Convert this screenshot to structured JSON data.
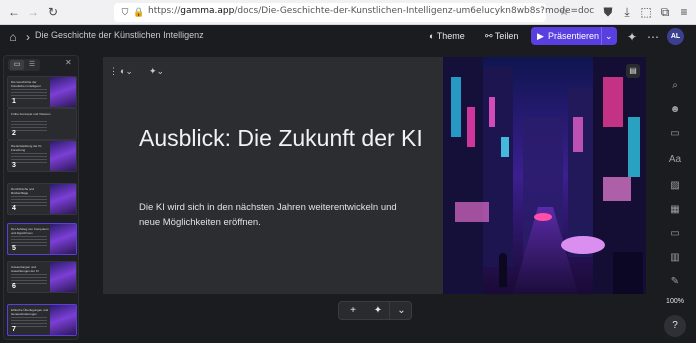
{
  "browser": {
    "url": "https://gamma.app/docs/Die-Geschichte-der-Kunstlichen-Intelligenz-um6elucykn8wb8s?mode=doc",
    "url_prefix": "https://",
    "url_host": "gamma.app",
    "url_path": "/docs/Die-Geschichte-der-Kunstlichen-Intelligenz-um6elucykn8wb8s?mode=doc"
  },
  "header": {
    "doc_title": "Die Geschichte der Künstlichen Intelligenz",
    "theme_label": "Theme",
    "share_label": "Teilen",
    "present_label": "Präsentieren",
    "avatar_initials": "AL"
  },
  "slide": {
    "heading": "Ausblick: Die Zukunft der KI",
    "body": "Die KI wird sich in den nächsten Jahren weiterentwickeln und neue Möglichkeiten eröffnen."
  },
  "thumbnails": [
    {
      "num": "1",
      "title": "Die Geschichte der Künstlichen Intelligenz"
    },
    {
      "num": "2",
      "title": "Frühe Konzepte und Visionen"
    },
    {
      "num": "3",
      "title": "Die Entwicklung der KI-Forschung"
    },
    {
      "num": "4",
      "title": "Durchbrüche und Rückschläge"
    },
    {
      "num": "5",
      "title": "Der Aufstieg von Computern und Algorithmen"
    },
    {
      "num": "6",
      "title": "Anwendungen und Auswirkungen der KI"
    },
    {
      "num": "7",
      "title": "Ethische Überlegungen und Herausforderungen"
    }
  ],
  "zoom_level": "100%",
  "help_label": "?",
  "colors": {
    "accent": "#5a3fe0",
    "background": "#1b1c1f",
    "slide_bg": "#2c2d30"
  }
}
